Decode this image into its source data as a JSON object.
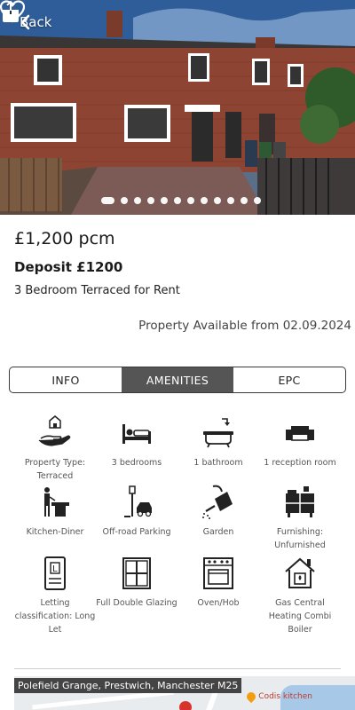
{
  "nav": {
    "back_label": "Back"
  },
  "gallery": {
    "image_count": 12,
    "active_index": 0
  },
  "listing": {
    "price": "£1,200 pcm",
    "deposit": "Deposit £1200",
    "property_summary": "3 Bedroom Terraced for Rent",
    "available": "Property Available from 02.09.2024"
  },
  "tabs": [
    {
      "label": "INFO",
      "active": false
    },
    {
      "label": "AMENITIES",
      "active": true
    },
    {
      "label": "EPC",
      "active": false
    }
  ],
  "amenities": [
    {
      "icon": "property-type-icon",
      "label": "Property Type: Terraced"
    },
    {
      "icon": "bed-icon",
      "label": "3 bedrooms"
    },
    {
      "icon": "bathtub-icon",
      "label": "1 bathroom"
    },
    {
      "icon": "sofa-icon",
      "label": "1 reception room"
    },
    {
      "icon": "kitchen-diner-icon",
      "label": "Kitchen-Diner"
    },
    {
      "icon": "parking-icon",
      "label": "Off-road Parking"
    },
    {
      "icon": "watering-can-icon",
      "label": "Garden"
    },
    {
      "icon": "furniture-icon",
      "label": "Furnishing: Unfurnished"
    },
    {
      "icon": "letting-document-icon",
      "label": "Letting classification: Long Let"
    },
    {
      "icon": "window-icon",
      "label": "Full Double Glazing"
    },
    {
      "icon": "oven-icon",
      "label": "Oven/Hob"
    },
    {
      "icon": "heating-house-icon",
      "label": "Gas Central Heating Combi Boiler"
    }
  ],
  "map": {
    "address": "Polefield Grange, Prestwich, Manchester M25",
    "poi_label": "Codis kitchen"
  },
  "colors": {
    "active_tab": "#555555",
    "text_muted": "#555555",
    "map_marker": "#d9342b"
  }
}
